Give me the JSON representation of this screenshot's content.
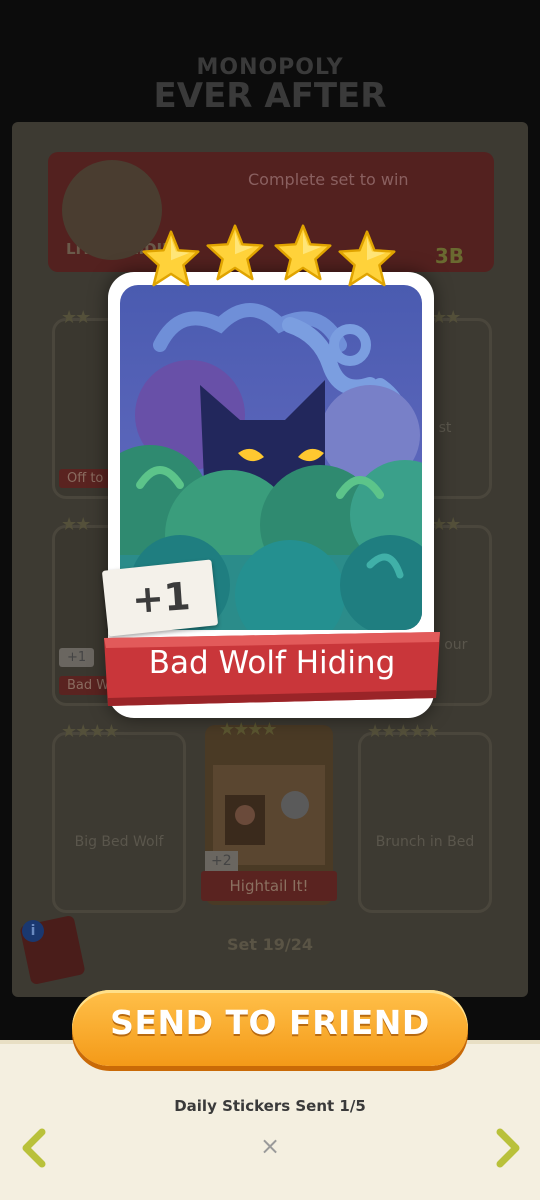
{
  "background": {
    "logo_line1": "MONOPOLY",
    "logo_line2": "EVER AFTER",
    "set_name": "LITTLE RIDIN",
    "complete_label": "Complete set to win",
    "reward_amount": "3B",
    "set_progress": "Set 19/24",
    "slots": [
      {
        "label": "Off to",
        "stars": 2
      },
      {
        "label": "st",
        "stars": 2
      },
      {
        "label": "Bad W",
        "plus": "+1",
        "stars": 2
      },
      {
        "label": "ny our",
        "stars": 2
      },
      {
        "label": "Big Bed Wolf",
        "stars": 4
      },
      {
        "label": "Hightail It!",
        "plus": "+2",
        "stars": 4
      },
      {
        "label": "Brunch in Bed",
        "stars": 5
      }
    ]
  },
  "card": {
    "title": "Bad Wolf Hiding",
    "count_badge": "+1",
    "stars": 4,
    "colors": {
      "star": "#ffd23a",
      "ribbon": "#c9363a",
      "frame": "#ffffff"
    }
  },
  "send_button": {
    "label": "SEND TO FRIEND"
  },
  "daily_status": "Daily Stickers Sent 1/5",
  "nav": {
    "prev_icon": "chevron-left-icon",
    "next_icon": "chevron-right-icon",
    "close_label": "×"
  }
}
